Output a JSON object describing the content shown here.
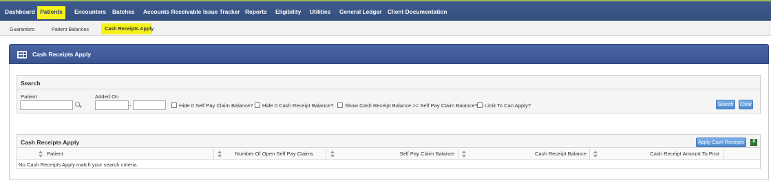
{
  "top_nav": [
    {
      "label": "Dashboard",
      "active": false
    },
    {
      "label": "Patients",
      "active": true
    },
    {
      "label": "Encounters",
      "active": false
    },
    {
      "label": "Batches",
      "active": false
    },
    {
      "label": "Accounts Receivable",
      "active": false
    },
    {
      "label": "Issue Tracker",
      "active": false
    },
    {
      "label": "Reports",
      "active": false
    },
    {
      "label": "Eligibility",
      "active": false
    },
    {
      "label": "Utilities",
      "active": false
    },
    {
      "label": "General Ledger",
      "active": false
    },
    {
      "label": "Client Documentation",
      "active": false
    }
  ],
  "sub_nav": [
    {
      "label": "Guarantors",
      "active": false
    },
    {
      "label": "Patient Balances",
      "active": false
    },
    {
      "label": "Cash Receipts Apply",
      "active": true
    }
  ],
  "panel": {
    "title": "Cash Receipts Apply",
    "icon": "grid-table-icon"
  },
  "search": {
    "title": "Search",
    "patient_label": "Patient",
    "patient_value": "",
    "added_on_label": "Added On",
    "date_from": "",
    "date_separator": "-",
    "date_to": "",
    "checkboxes": [
      {
        "label": "Hide 0 Self Pay Claim Balance?",
        "checked": false
      },
      {
        "label": "Hide 0 Cash Receipt Balance?",
        "checked": false
      },
      {
        "label": "Show Cash Receipt Balance >= Self Pay Claim Balance?",
        "checked": false
      },
      {
        "label": "Limit To Can Apply?",
        "checked": false
      }
    ],
    "search_button": "Search",
    "clear_button": "Clear"
  },
  "results": {
    "title": "Cash Receipts Apply",
    "apply_button": "Apply Cash Receipts",
    "export_icon": "excel-export-icon",
    "columns": [
      "Patient",
      "Number Of Open Self Pay Claims",
      "Self Pay Claim Balance",
      "Cash Receipt Balance",
      "Cash Receipt Amount To Post"
    ],
    "empty_message": "No Cash Receipts Apply match your search criteria."
  },
  "colors": {
    "nav_bg": "#3f5b8e",
    "highlight": "#f7f21c",
    "button": "#5a94d6"
  }
}
